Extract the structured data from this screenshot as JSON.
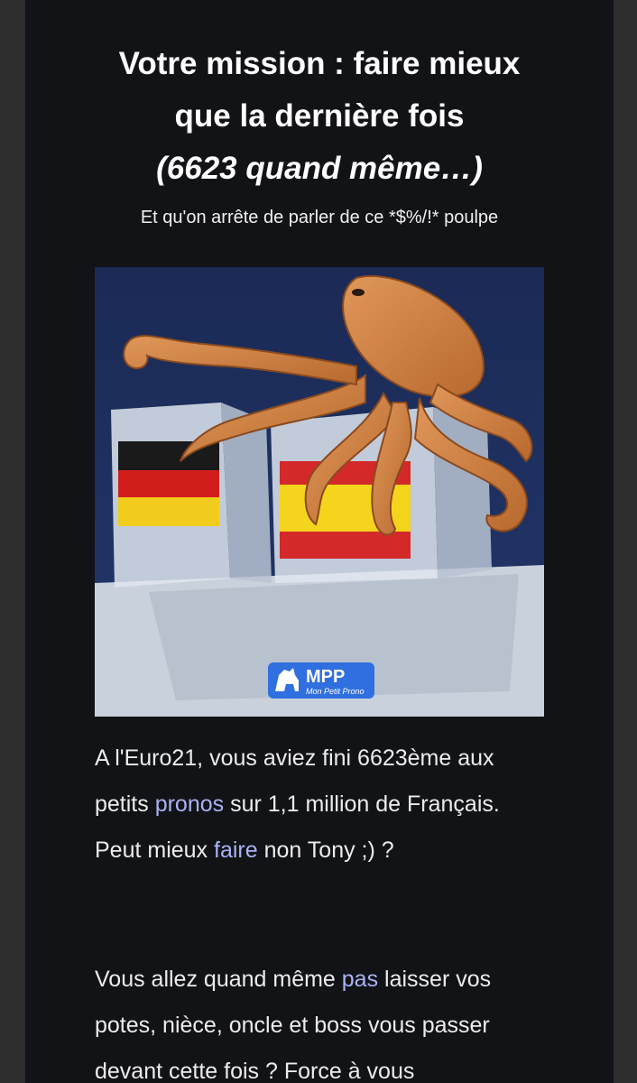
{
  "headline": {
    "line1": "Votre mission : faire mieux",
    "line2": "que la dernière fois",
    "line3": "(6623 quand même…)"
  },
  "subtitle": "Et qu'on arrête de parler de ce *$%/!* poulpe",
  "hero_image": {
    "logo_text": "MPP",
    "logo_tagline": "Mon Petit Prono"
  },
  "paragraph1": {
    "part1": "A l'Euro21, vous aviez fini 6623ème aux petits ",
    "link1": "pronos",
    "part2": " sur 1,1 million de Français. Peut mieux ",
    "link2": "faire",
    "part3": " non Tony ;) ?"
  },
  "paragraph2": {
    "part1": "Vous allez quand même ",
    "link1": "pas",
    "part2": " laisser vos potes, nièce, oncle et boss vous passer devant cette fois ? Force à vous"
  },
  "colors": {
    "background": "#121316",
    "text": "#ececec",
    "link": "#aab2f5",
    "logo_blue": "#2f6fe0"
  }
}
